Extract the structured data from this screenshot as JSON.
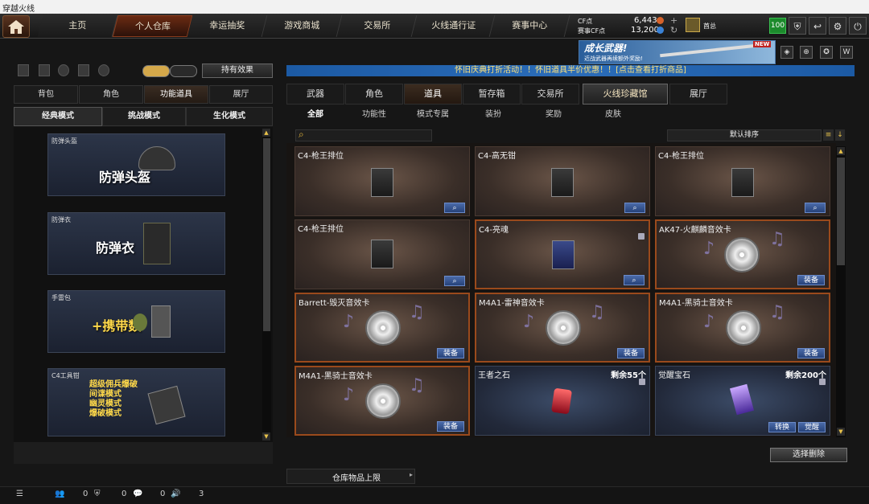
{
  "window": {
    "title": "穿越火线"
  },
  "nav": {
    "items": [
      "主页",
      "个人仓库",
      "幸运抽奖",
      "游戏商城",
      "交易所",
      "火线通行证",
      "赛事中心"
    ],
    "active": "个人仓库"
  },
  "currency": {
    "cf_label": "CF点",
    "cf_value": "6,443",
    "match_label": "赛事CF点",
    "match_value": "13,200"
  },
  "user": {
    "name": "酋总",
    "rank_level": "100"
  },
  "topicons": [
    "shield-icon",
    "exit-icon",
    "settings-icon",
    "power-icon"
  ],
  "left": {
    "effect_btn": "持有效果",
    "tabs": [
      "背包",
      "角色",
      "功能道具",
      "展厅"
    ],
    "active_tab": "功能道具",
    "modes": [
      "经典模式",
      "挑战模式",
      "生化模式"
    ],
    "active_mode": "经典模式",
    "cards": [
      {
        "label": "防弹头盔",
        "big": "防弹头盔"
      },
      {
        "label": "防弹衣",
        "big": "防弹衣"
      },
      {
        "label": "手雷包",
        "big": "+携带数"
      },
      {
        "label": "C4工具钳",
        "lines": [
          "超级佣兵爆破",
          "间谍模式",
          "幽灵模式",
          "爆破模式"
        ]
      }
    ]
  },
  "promo": {
    "title": "成长武器!",
    "subtitle": "近战武器再续额外奖励!",
    "badge": "NEW"
  },
  "banner": "怀旧庆典打折活动！！怀旧道具半价优惠！！[点击查看打折商品]",
  "categories": [
    "武器",
    "角色",
    "道具",
    "暂存箱",
    "交易所",
    "火线珍藏馆",
    "展厅"
  ],
  "active_category": "道具",
  "subtabs": [
    "全部",
    "功能性",
    "模式专属",
    "装扮",
    "奖励",
    "皮肤"
  ],
  "active_subtab": "全部",
  "sort": "默认排序",
  "items": [
    {
      "name": "C4-枪王排位",
      "type": "c4",
      "btn": ""
    },
    {
      "name": "C4-高无钳",
      "type": "c4",
      "btn": ""
    },
    {
      "name": "C4-枪王排位",
      "type": "c4",
      "btn": ""
    },
    {
      "name": "C4-枪王排位",
      "type": "c4",
      "btn": ""
    },
    {
      "name": "C4-亮魂",
      "type": "c4",
      "btn": "",
      "lock": true
    },
    {
      "name": "AK47-火麒麟音效卡",
      "type": "disc",
      "btn": "装备"
    },
    {
      "name": "Barrett-毁灭音效卡",
      "type": "disc",
      "btn": "装备"
    },
    {
      "name": "M4A1-雷神音效卡",
      "type": "disc",
      "btn": "装备"
    },
    {
      "name": "M4A1-黑骑士音效卡",
      "type": "disc",
      "btn": "装备"
    },
    {
      "name": "M4A1-黑骑士音效卡",
      "type": "disc",
      "btn": "装备"
    },
    {
      "name": "王者之石",
      "type": "ruby",
      "qty": "剩余55个",
      "lock": true
    },
    {
      "name": "觉醒宝石",
      "type": "amethyst",
      "qty": "剩余200个",
      "btns": [
        "转换",
        "觉醒"
      ],
      "lock": true
    }
  ],
  "select_delete": "选择删除",
  "capacity": "仓库物品上限",
  "status": {
    "v1": "0",
    "v2": "0",
    "v3": "0",
    "v4": "3"
  }
}
